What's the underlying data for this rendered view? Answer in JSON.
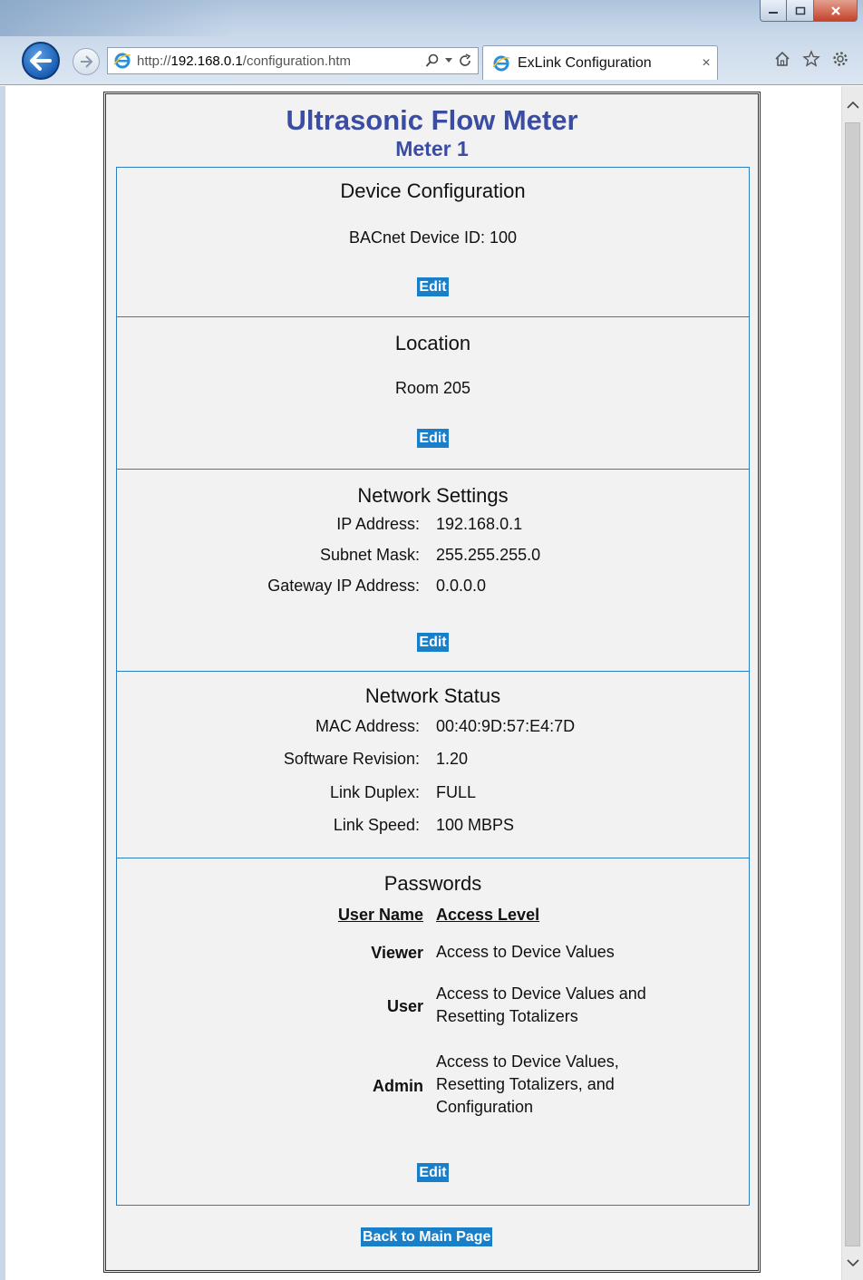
{
  "browser": {
    "url_prefix": "http://",
    "url_host": "192.168.0.1",
    "url_path": "/configuration.htm",
    "tab_title": "ExLink Configuration",
    "tab_close": "×"
  },
  "page": {
    "title": "Ultrasonic Flow Meter",
    "subtitle": "Meter 1",
    "back_label": "Back to Main Page"
  },
  "device_config": {
    "title": "Device Configuration",
    "value": "BACnet Device ID: 100",
    "edit_label": "Edit"
  },
  "location": {
    "title": "Location",
    "value": "Room 205",
    "edit_label": "Edit"
  },
  "network_settings": {
    "title": "Network Settings",
    "rows": [
      {
        "label": "IP Address:",
        "value": "192.168.0.1"
      },
      {
        "label": "Subnet Mask:",
        "value": "255.255.255.0"
      },
      {
        "label": "Gateway IP Address:",
        "value": "0.0.0.0"
      }
    ],
    "edit_label": "Edit"
  },
  "network_status": {
    "title": "Network Status",
    "rows": [
      {
        "label": "MAC Address:",
        "value": "00:40:9D:57:E4:7D"
      },
      {
        "label": "Software Revision:",
        "value": "1.20"
      },
      {
        "label": "Link Duplex:",
        "value": "FULL"
      },
      {
        "label": "Link Speed:",
        "value": "100 MBPS"
      }
    ]
  },
  "passwords": {
    "title": "Passwords",
    "col_user": "User Name",
    "col_access": "Access Level",
    "rows": [
      {
        "name": "Viewer",
        "access": "Access to Device Values"
      },
      {
        "name": "User",
        "access": "Access to Device Values and Resetting Totalizers"
      },
      {
        "name": "Admin",
        "access": "Access to Device Values, Resetting Totalizers, and Configuration"
      }
    ],
    "edit_label": "Edit"
  },
  "colors": {
    "title_blue": "#3b4da3",
    "button_blue": "#1a7fc9",
    "section_border": "#2b7ec1"
  }
}
